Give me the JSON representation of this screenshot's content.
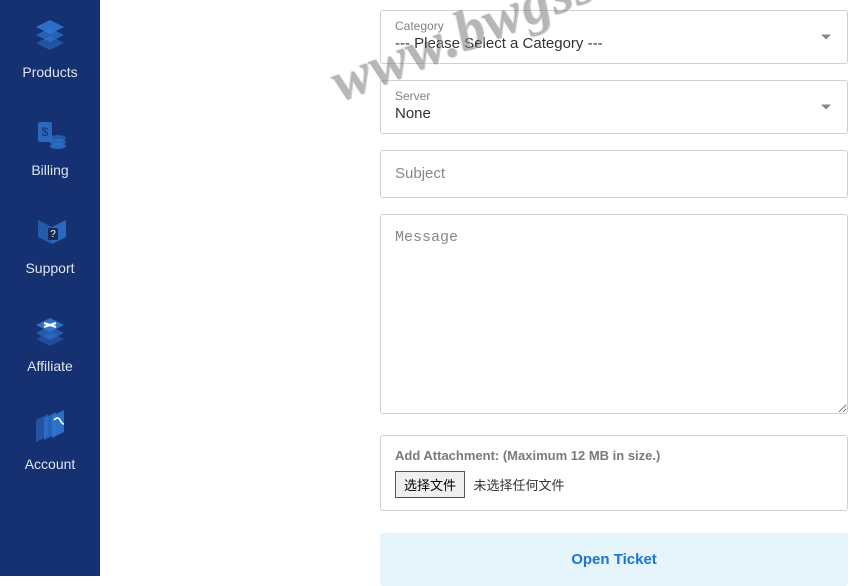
{
  "sidebar": {
    "items": [
      {
        "label": "Products",
        "icon": "layers-icon"
      },
      {
        "label": "Billing",
        "icon": "billing-icon"
      },
      {
        "label": "Support",
        "icon": "support-icon"
      },
      {
        "label": "Affiliate",
        "icon": "affiliate-icon"
      },
      {
        "label": "Account",
        "icon": "account-icon"
      }
    ]
  },
  "form": {
    "category": {
      "label": "Category",
      "value": "--- Please Select a Category ---"
    },
    "server": {
      "label": "Server",
      "value": "None"
    },
    "subject_placeholder": "Subject",
    "message_placeholder": "Message",
    "attachment": {
      "label": "Add Attachment: (Maximum 12 MB in size.)",
      "button": "选择文件",
      "status": "未选择任何文件"
    },
    "submit_label": "Open Ticket"
  },
  "watermark": "www.bwgss.org"
}
